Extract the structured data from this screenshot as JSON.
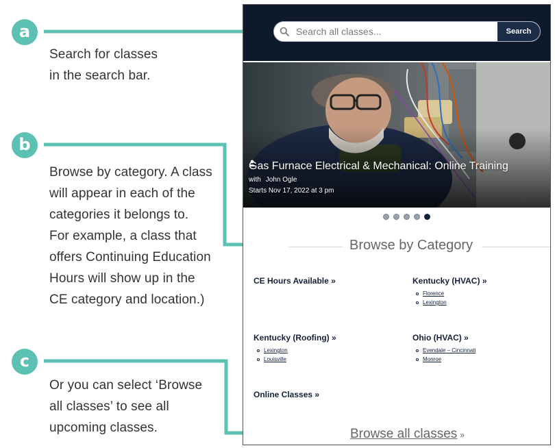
{
  "annotations": {
    "a": {
      "badge": "a",
      "lines": [
        "Search for classes",
        "in the search bar."
      ]
    },
    "b": {
      "badge": "b",
      "lines": [
        "Browse by category. A class",
        "will appear in each of the",
        "categories it belongs to.",
        "For example, a class that",
        "offers Continuing Education",
        "Hours will show up in the",
        "CE category and location.)"
      ]
    },
    "c": {
      "badge": "c",
      "lines": [
        "Or you can select ‘Browse",
        "all classes’ to see all",
        "upcoming classes."
      ]
    }
  },
  "search": {
    "placeholder": "Search all classes...",
    "button_label": "Search"
  },
  "hero": {
    "title": "Gas Furnace Electrical & Mechanical: Online Training",
    "with_label": "with",
    "instructor": "John Ogle",
    "start": "Starts Nov 17, 2022 at 3 pm"
  },
  "carousel": {
    "count": 5,
    "active_index": 4
  },
  "categories": {
    "heading": "Browse by Category",
    "items": [
      {
        "title": "CE Hours Available",
        "links": []
      },
      {
        "title": "Kentucky (HVAC)",
        "links": [
          "Florence",
          "Lexington"
        ]
      },
      {
        "title": "Kentucky (Roofing)",
        "links": [
          "Lexington",
          "Louisville"
        ]
      },
      {
        "title": "Ohio (HVAC)",
        "links": [
          "Evendale – Cincinnati",
          "Monroe"
        ]
      },
      {
        "title": "Online Classes",
        "links": []
      }
    ]
  },
  "browse_all": {
    "label": "Browse all classes",
    "suffix": "»"
  },
  "raquo": "»",
  "colors": {
    "accent": "#5cc0b3",
    "navy": "#0e1a2b",
    "button": "#1a2c48"
  },
  "icons": {
    "search": "search-icon",
    "person": "person-icon"
  }
}
